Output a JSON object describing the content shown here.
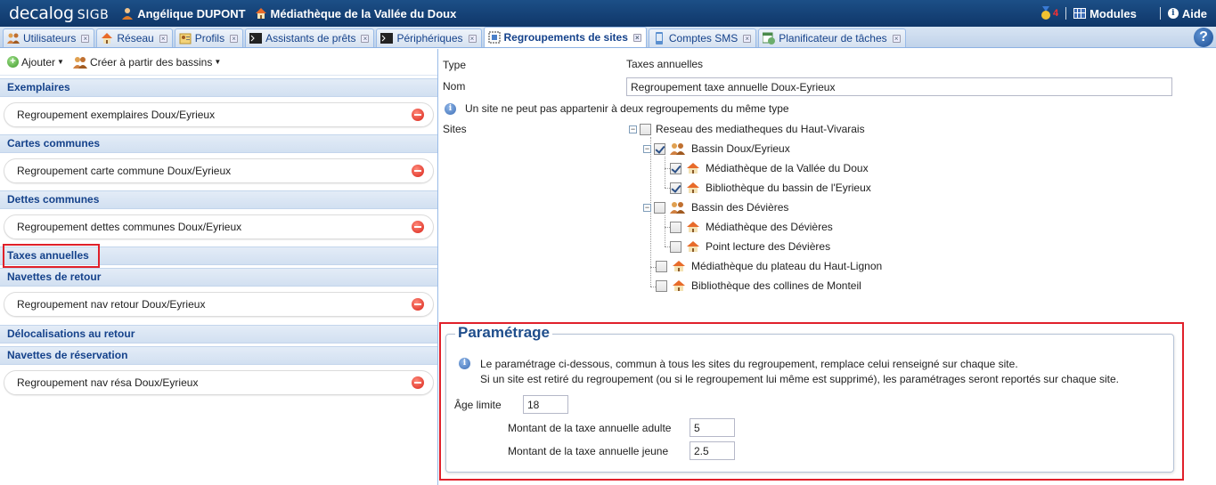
{
  "topbar": {
    "logo": "decalog",
    "logo_suffix": "SIGB",
    "user_name": "Angélique DUPONT",
    "library_name": "Médiathèque de la Vallée du Doux",
    "notification_count": "4",
    "modules_label": "Modules",
    "help_label": "Aide"
  },
  "tabs": [
    {
      "label": "Utilisateurs"
    },
    {
      "label": "Réseau"
    },
    {
      "label": "Profils"
    },
    {
      "label": "Assistants de prêts"
    },
    {
      "label": "Périphériques"
    },
    {
      "label": "Regroupements de sites"
    },
    {
      "label": "Comptes SMS"
    },
    {
      "label": "Planificateur de tâches"
    }
  ],
  "help_button": "?",
  "left": {
    "toolbar": {
      "add_label": "Ajouter",
      "create_from_label": "Créer à partir des bassins"
    },
    "groups": [
      {
        "header": "Exemplaires",
        "items": [
          "Regroupement exemplaires Doux/Eyrieux"
        ]
      },
      {
        "header": "Cartes communes",
        "items": [
          "Regroupement carte commune Doux/Eyrieux"
        ]
      },
      {
        "header": "Dettes communes",
        "items": [
          "Regroupement dettes communes Doux/Eyrieux"
        ]
      },
      {
        "header": "Taxes annuelles",
        "items": []
      },
      {
        "header": "Navettes de retour",
        "items": [
          "Regroupement nav retour Doux/Eyrieux"
        ]
      },
      {
        "header": "Délocalisations au retour",
        "items": []
      },
      {
        "header": "Navettes de réservation",
        "items": [
          "Regroupement nav résa Doux/Eyrieux"
        ]
      }
    ]
  },
  "form": {
    "type_label": "Type",
    "type_value": "Taxes annuelles",
    "name_label": "Nom",
    "name_value": "Regroupement taxe annuelle Doux-Eyrieux",
    "info_text": "Un site ne peut pas appartenir à deux regroupements du même type",
    "sites_label": "Sites",
    "tree": {
      "root": "Reseau des mediatheques du Haut-Vivarais",
      "bassin1": "Bassin Doux/Eyrieux",
      "bassin1_sites": [
        "Médiathèque de la Vallée du Doux",
        "Bibliothèque du bassin de l'Eyrieux"
      ],
      "bassin2": "Bassin des Dévières",
      "bassin2_sites": [
        "Médiathèque des Dévières",
        "Point lecture des Dévières"
      ],
      "other_sites": [
        "Médiathèque du plateau du Haut-Lignon",
        "Bibliothèque des collines de Monteil"
      ]
    }
  },
  "param": {
    "legend": "Paramétrage",
    "info_line1": "Le paramétrage ci-dessous, commun à tous les sites du regroupement, remplace celui renseigné sur chaque site.",
    "info_line2": "Si un site est retiré du regroupement (ou si le regroupement lui même est supprimé), les paramétrages seront reportés sur chaque site.",
    "age_label": "Âge limite",
    "age_value": "18",
    "adult_label": "Montant de la taxe annuelle adulte",
    "adult_value": "5",
    "young_label": "Montant de la taxe annuelle jeune",
    "young_value": "2.5"
  },
  "colors": {
    "topbar": "#0f3668",
    "accent": "#15428b",
    "highlight": "#e0202a"
  }
}
